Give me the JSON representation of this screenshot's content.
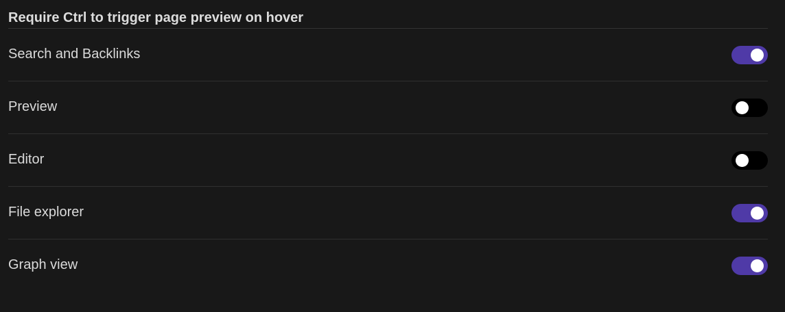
{
  "section": {
    "heading": "Require Ctrl to trigger page preview on hover"
  },
  "settings": [
    {
      "label": "Search and Backlinks",
      "enabled": true
    },
    {
      "label": "Preview",
      "enabled": false
    },
    {
      "label": "Editor",
      "enabled": false
    },
    {
      "label": "File explorer",
      "enabled": true
    },
    {
      "label": "Graph view",
      "enabled": true
    }
  ],
  "colors": {
    "background": "#181818",
    "toggle_on": "#4f3aa7",
    "toggle_off": "#000000",
    "knob": "#ffffff",
    "text": "#dadada"
  }
}
